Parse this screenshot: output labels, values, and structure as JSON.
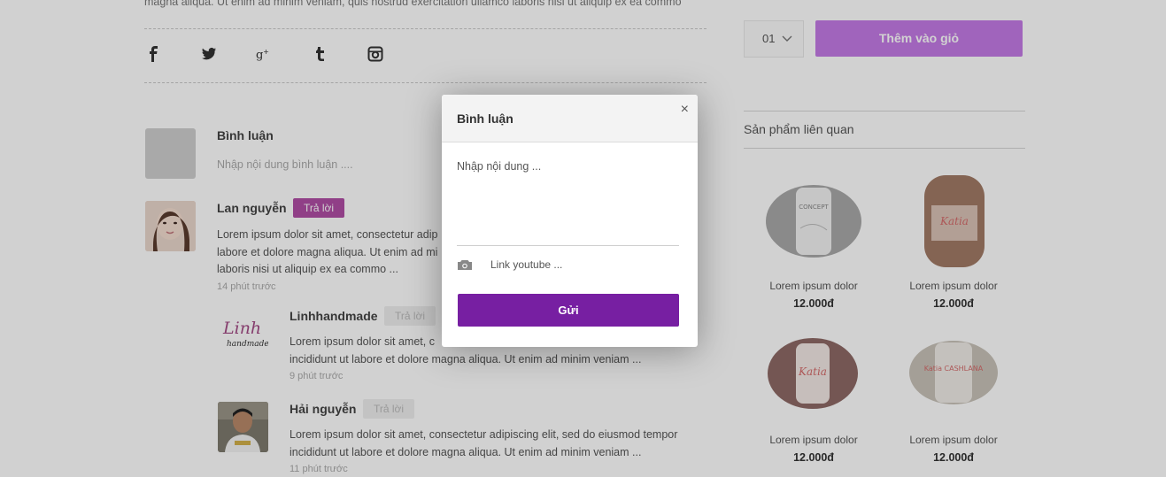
{
  "product": {
    "description_tail": "magna aliqua. Ut enim ad minim veniam, quis nostrud exercitation ullamco laboris nisi ut aliquip ex ea commo",
    "quantity": "01",
    "add_to_cart_label": "Thêm vào giỏ"
  },
  "share": {
    "icons": [
      "facebook-icon",
      "twitter-icon",
      "google-plus-icon",
      "tumblr-icon",
      "instagram-icon"
    ]
  },
  "comments": {
    "section_title": "Bình luận",
    "input_placeholder": "Nhập nội dung bình luận ....",
    "items": [
      {
        "name": "Lan nguyễn",
        "reply_label": "Trả lời",
        "text_lines": [
          "Lorem ipsum dolor sit amet, consectetur adip",
          "labore et dolore magna aliqua. Ut enim ad mi",
          "laboris nisi ut aliquip ex ea commo ..."
        ],
        "time": "14 phút trước"
      },
      {
        "name": "Linhhandmade",
        "reply_label": "Trả lời",
        "text_lines": [
          "Lorem ipsum dolor sit amet, c",
          "incididunt ut labore et dolore magna aliqua. Ut enim ad minim veniam ..."
        ],
        "time": "9 phút trước",
        "avatar_logo_text": [
          "Linh",
          "handmade"
        ]
      },
      {
        "name": "Hải nguyễn",
        "reply_label": "Trả lời",
        "text_lines": [
          "Lorem ipsum dolor sit amet, consectetur adipiscing elit, sed do eiusmod tempor",
          "incididunt ut labore et dolore magna aliqua. Ut enim ad minim veniam ..."
        ],
        "time": "11 phút trước"
      }
    ]
  },
  "related": {
    "title": "Sản phẩm liên quan",
    "products": [
      {
        "name": "Lorem ipsum dolor",
        "price": "12.000đ",
        "label": "CONCEPT",
        "color": "#a9a9a9"
      },
      {
        "name": "Lorem ipsum dolor",
        "price": "12.000đ",
        "label": "Katia",
        "color": "#a27a66"
      },
      {
        "name": "Lorem ipsum dolor",
        "price": "12.000đ",
        "label": "Katia",
        "color": "#8e6a66"
      },
      {
        "name": "Lorem ipsum dolor",
        "price": "12.000đ",
        "label": "Katia CASHLANA",
        "color": "#c9c3b9"
      }
    ]
  },
  "modal": {
    "title": "Bình luận",
    "close_symbol": "×",
    "content_placeholder": "Nhập nội dung ...",
    "link_placeholder": "Link youtube ...",
    "submit_label": "Gửi"
  },
  "colors": {
    "accent_purple": "#771fa2",
    "cart_purple": "#c47ae6",
    "reply_pink": "#b04ea5"
  }
}
